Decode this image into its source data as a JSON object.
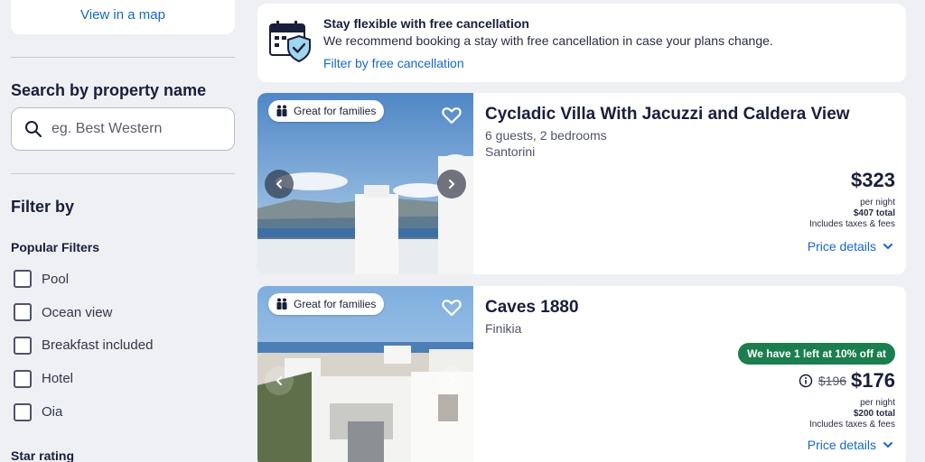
{
  "sidebar": {
    "map_link": "View in a map",
    "search_title": "Search by property name",
    "search_placeholder": "eg. Best Western",
    "filter_title": "Filter by",
    "popular_title": "Popular Filters",
    "filters": [
      "Pool",
      "Ocean view",
      "Breakfast included",
      "Hotel",
      "Oia"
    ],
    "star_title": "Star rating"
  },
  "banner": {
    "title": "Stay flexible with free cancellation",
    "text": "We recommend booking a stay with free cancellation in case your plans change.",
    "link": "Filter by free cancellation"
  },
  "properties": [
    {
      "badge": "Great for families",
      "title": "Cycladic Villa With Jacuzzi and Caldera View",
      "details": "6 guests, 2 bedrooms",
      "location": "Santorini",
      "price": "$323",
      "per_night": "per night",
      "total": "$407 total",
      "taxes": "Includes taxes & fees",
      "price_details": "Price details"
    },
    {
      "badge": "Great for families",
      "title": "Caves 1880",
      "location": "Finikia",
      "deal": "We have 1 left at 10% off at",
      "old_price": "$196",
      "price": "$176",
      "per_night": "per night",
      "total": "$200 total",
      "taxes": "Includes taxes & fees",
      "price_details": "Price details"
    }
  ],
  "colors": {
    "link": "#1668c7",
    "navy": "#191e3b",
    "deal": "#1b7e4f",
    "background": "#eef0f4"
  }
}
